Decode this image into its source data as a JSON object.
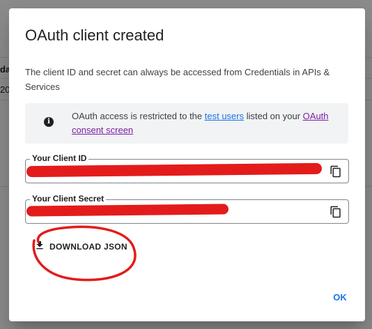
{
  "background": {
    "partial_text_1": "da",
    "partial_text_2": "20"
  },
  "dialog": {
    "title": "OAuth client created",
    "description": "The client ID and secret can always be accessed from Credentials in APIs & Services",
    "info": {
      "icon": "info-icon",
      "text_before": "OAuth access is restricted to the ",
      "link_test_users": "test users",
      "text_middle": " listed on your ",
      "link_consent": "OAuth consent screen"
    },
    "client_id": {
      "label": "Your Client ID",
      "icon": "copy-icon"
    },
    "client_secret": {
      "label": "Your Client Secret",
      "icon": "copy-icon"
    },
    "download_label": "DOWNLOAD JSON",
    "ok_label": "OK"
  },
  "colors": {
    "accent": "#1a73e8",
    "visited_link": "#7b1fa2",
    "redaction": "#e41b1b",
    "annotation": "#e41b1b"
  }
}
